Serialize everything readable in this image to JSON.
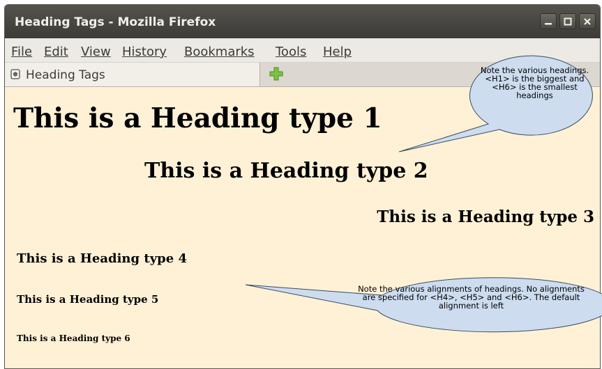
{
  "window": {
    "title": "Heading Tags - Mozilla Firefox"
  },
  "menu": [
    {
      "label": "File"
    },
    {
      "label": "Edit"
    },
    {
      "label": "View"
    },
    {
      "label": "History"
    },
    {
      "label": "Bookmarks"
    },
    {
      "label": "Tools"
    },
    {
      "label": "Help"
    }
  ],
  "tabs": [
    {
      "label": "Heading Tags",
      "icon": "page-icon"
    }
  ],
  "new_tab_icon": "plus-icon",
  "page": {
    "h1": "This is a Heading type 1",
    "h2": "This is a Heading type 2",
    "h3": "This is a Heading type 3",
    "h4": "This is a Heading type 4",
    "h5": "This is a Heading type 5",
    "h6": "This is a Heading type 6"
  },
  "callouts": [
    {
      "text": "Note the various headings. <H1> is the biggest and <H6> is the smallest headings"
    },
    {
      "text": "Note the various alignments of headings. No alignments are specified for <H4>, <H5> and <H6>. The default alignment is left"
    }
  ],
  "colors": {
    "page_background": "#fff1d6",
    "titlebar": "#3c3b37",
    "callout_fill": "#cddcef",
    "callout_border": "#3a4a5e",
    "new_tab_green": "#7cc243"
  }
}
